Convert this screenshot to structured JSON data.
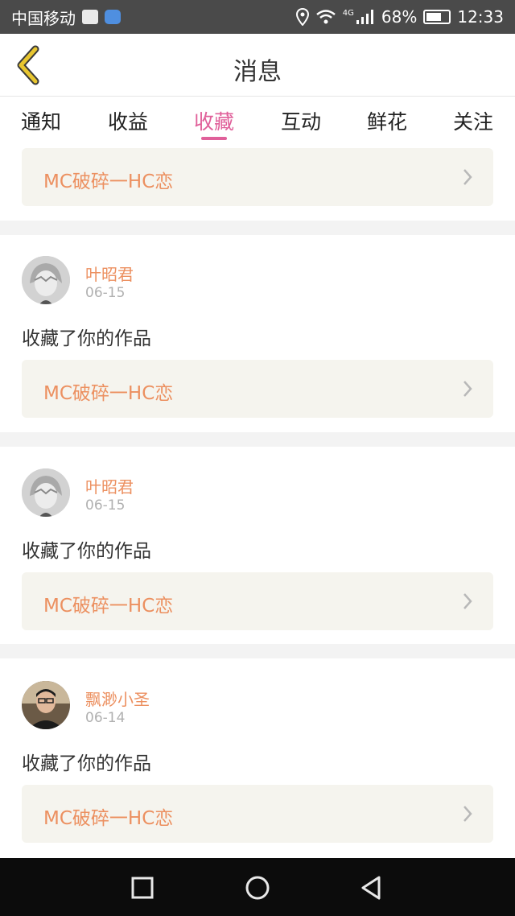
{
  "status_bar": {
    "carrier": "中国移动",
    "network": "4G",
    "battery": "68%",
    "battery_level": 0.68,
    "time": "12:33"
  },
  "header": {
    "title": "消息",
    "back_icon": "chevron-left-icon"
  },
  "tabs": [
    {
      "label": "通知",
      "active": false
    },
    {
      "label": "收益",
      "active": false
    },
    {
      "label": "收藏",
      "active": true
    },
    {
      "label": "互动",
      "active": false
    },
    {
      "label": "鲜花",
      "active": false
    },
    {
      "label": "关注",
      "active": false
    }
  ],
  "top_work_card": {
    "title": "MC破碎一HC恋"
  },
  "notifications": [
    {
      "username": "叶昭君",
      "date": "06-15",
      "message": "收藏了你的作品",
      "work_title": "MC破碎一HC恋",
      "avatar": "anime-avatar"
    },
    {
      "username": "叶昭君",
      "date": "06-15",
      "message": "收藏了你的作品",
      "work_title": "MC破碎一HC恋",
      "avatar": "anime-avatar"
    },
    {
      "username": "飘渺小圣",
      "date": "06-14",
      "message": "收藏了你的作品",
      "work_title": "MC破碎一HC恋",
      "avatar": "photo-avatar"
    }
  ],
  "colors": {
    "accent_pink": "#e0609a",
    "accent_orange": "#ec9060",
    "back_yellow": "#d7b320",
    "card_bg": "#f5f4ee"
  },
  "nav_bar": {
    "square_icon": "recent-apps-icon",
    "circle_icon": "home-icon",
    "triangle_icon": "back-icon"
  }
}
